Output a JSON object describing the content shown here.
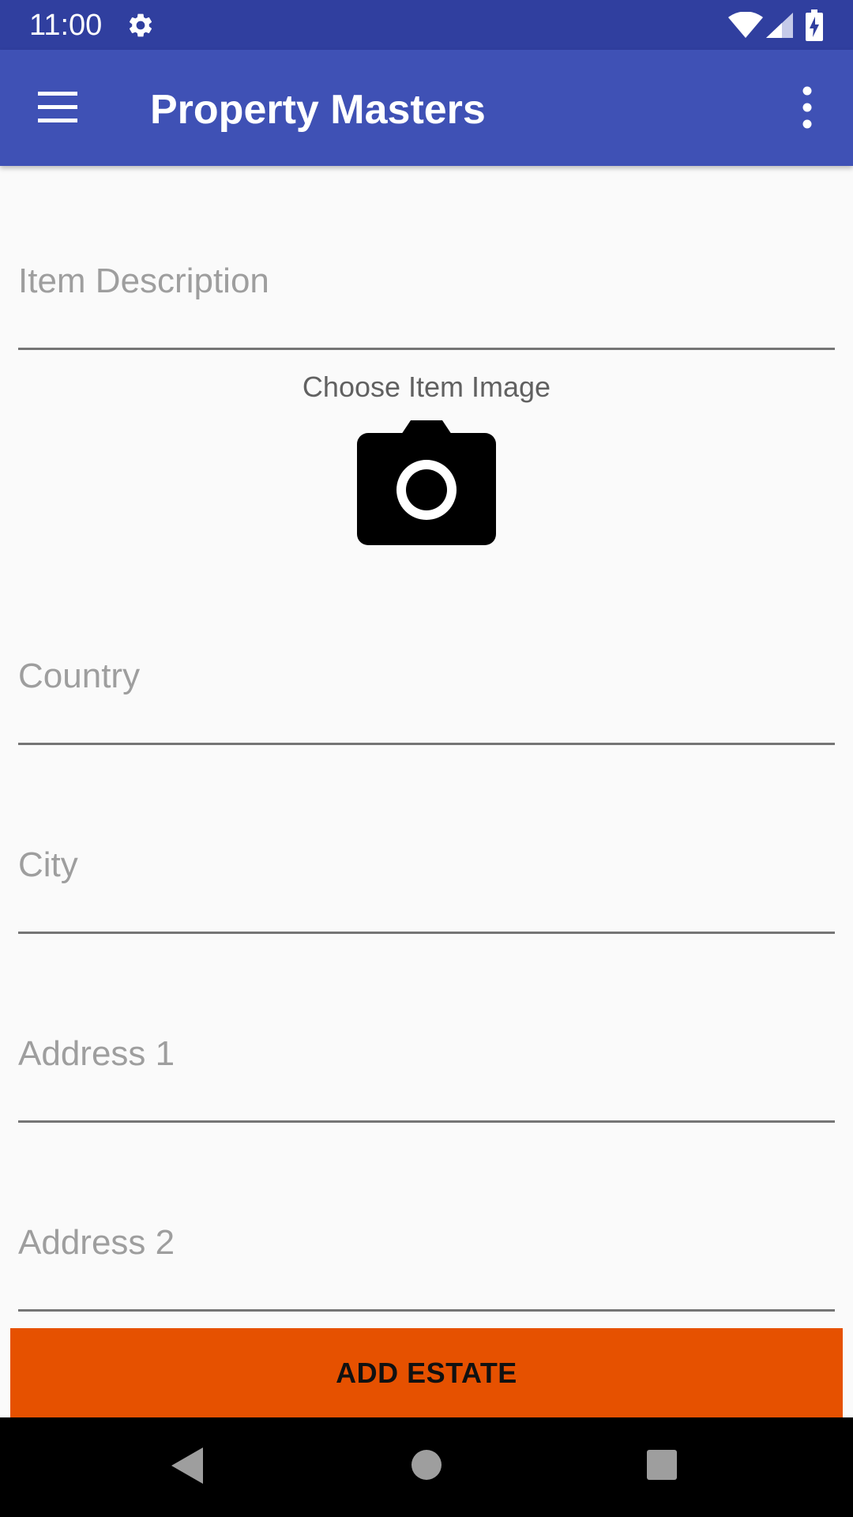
{
  "status_bar": {
    "time": "11:00",
    "icons": [
      "settings-icon",
      "wifi-icon",
      "cell-signal-icon",
      "battery-charging-icon"
    ]
  },
  "app_bar": {
    "title": "Property Masters",
    "menu_icon": "hamburger-menu-icon",
    "overflow_icon": "more-vert-icon",
    "color": "#3f51b5"
  },
  "form": {
    "item_description": {
      "placeholder": "Item Description",
      "value": ""
    },
    "image_caption": "Choose Item Image",
    "image_icon": "camera-icon",
    "country": {
      "placeholder": "Country",
      "value": ""
    },
    "city": {
      "placeholder": "City",
      "value": ""
    },
    "address1": {
      "placeholder": "Address 1",
      "value": ""
    },
    "address2": {
      "placeholder": "Address 2",
      "value": ""
    }
  },
  "submit_button": {
    "label": "ADD ESTATE",
    "color": "#e65100"
  },
  "nav_bar": {
    "icons": [
      "back-icon",
      "home-icon",
      "recents-icon"
    ]
  }
}
